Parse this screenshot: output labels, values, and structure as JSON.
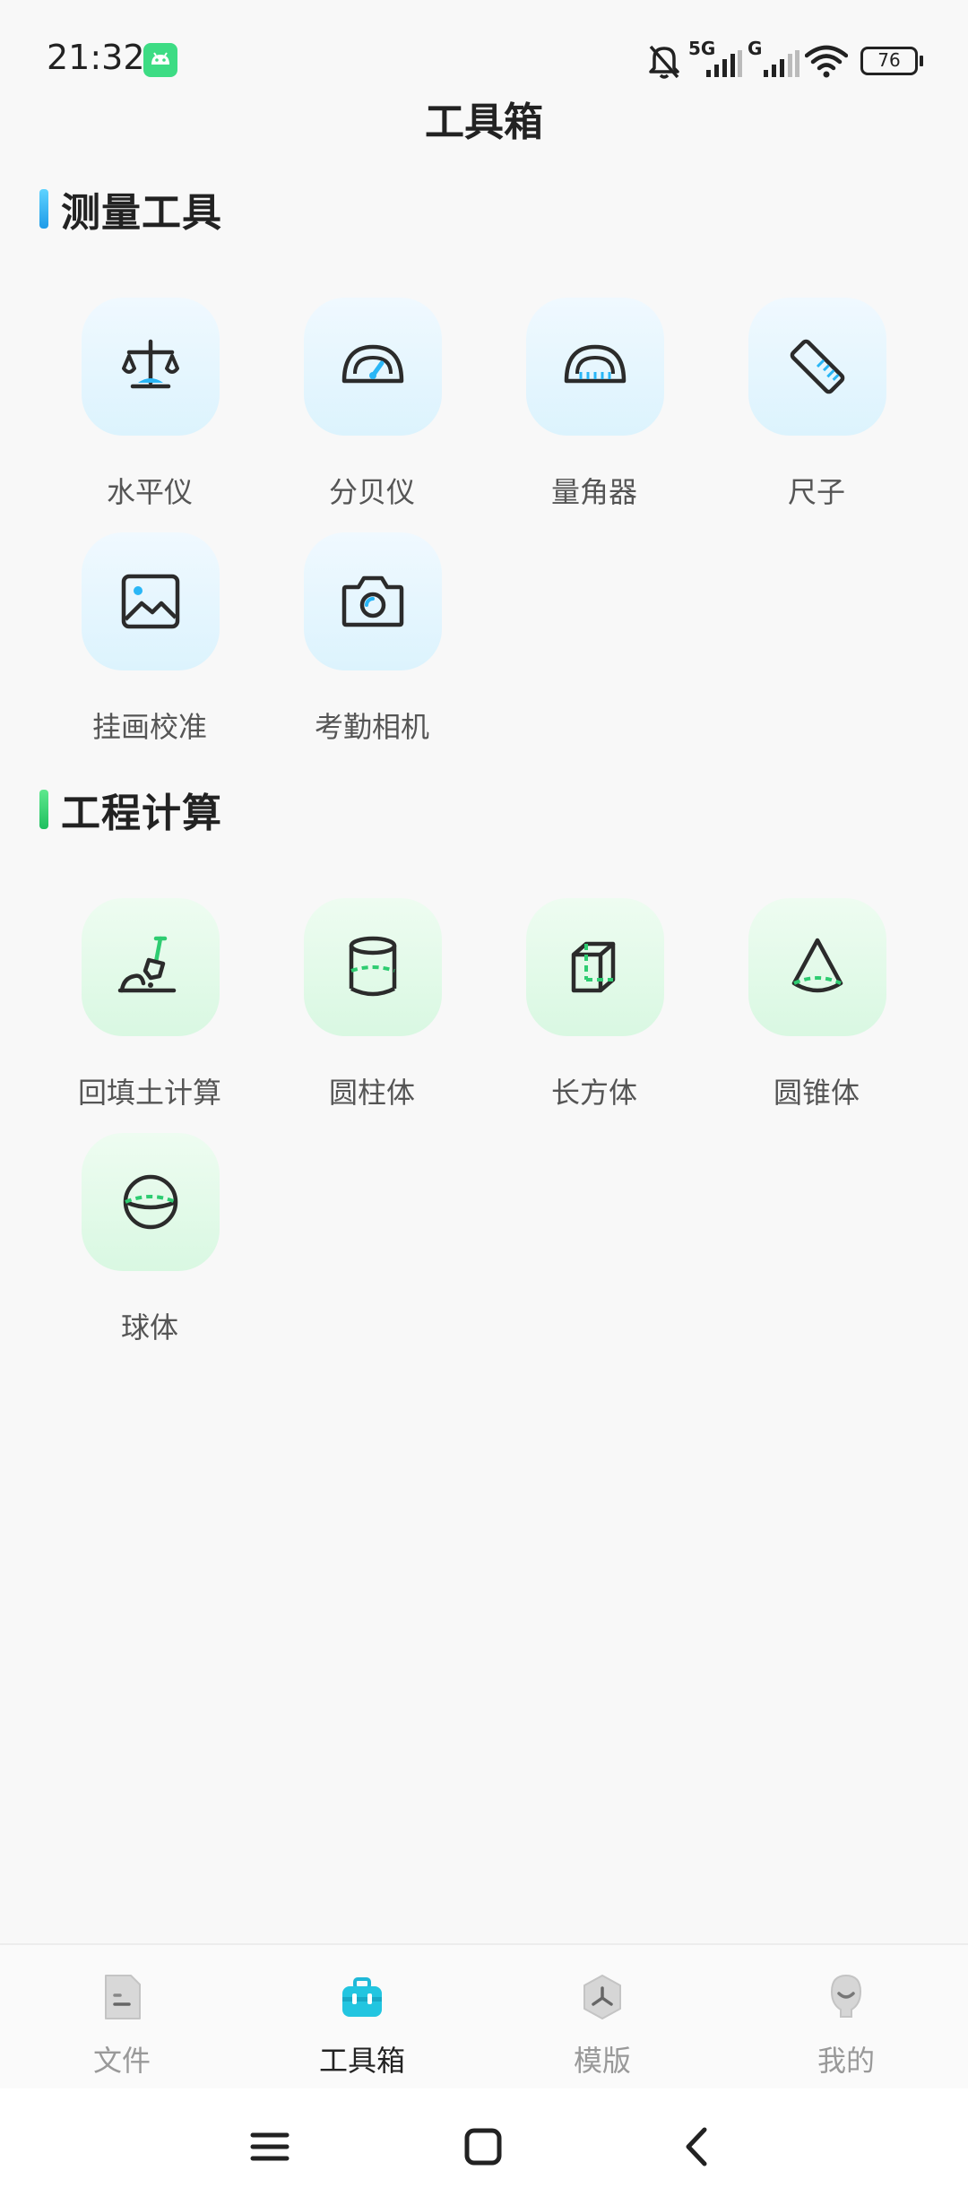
{
  "status_bar": {
    "time": "21:32",
    "network_1": "5G",
    "network_2": "G",
    "battery": "76",
    "icons": [
      "android-app-icon",
      "bell-muted-icon",
      "signal-icon",
      "signal-icon",
      "wifi-icon",
      "battery-icon"
    ]
  },
  "page": {
    "title": "工具箱"
  },
  "sections": [
    {
      "title": "测量工具",
      "accent": "#29b6f6",
      "items": [
        {
          "label": "水平仪",
          "icon": "level-icon"
        },
        {
          "label": "分贝仪",
          "icon": "decibel-meter-icon"
        },
        {
          "label": "量角器",
          "icon": "protractor-icon"
        },
        {
          "label": "尺子",
          "icon": "ruler-icon"
        },
        {
          "label": "挂画校准",
          "icon": "picture-frame-icon"
        },
        {
          "label": "考勤相机",
          "icon": "camera-icon"
        }
      ]
    },
    {
      "title": "工程计算",
      "accent": "#2ecc71",
      "items": [
        {
          "label": "回填土计算",
          "icon": "shovel-icon"
        },
        {
          "label": "圆柱体",
          "icon": "cylinder-icon"
        },
        {
          "label": "长方体",
          "icon": "cuboid-icon"
        },
        {
          "label": "圆锥体",
          "icon": "cone-icon"
        },
        {
          "label": "球体",
          "icon": "sphere-icon"
        }
      ]
    }
  ],
  "bottom_nav": {
    "active": "工具箱",
    "items": [
      {
        "label": "文件",
        "icon": "file-icon"
      },
      {
        "label": "工具箱",
        "icon": "toolbox-icon"
      },
      {
        "label": "模版",
        "icon": "template-icon"
      },
      {
        "label": "我的",
        "icon": "profile-icon"
      }
    ]
  },
  "colors": {
    "blue_accent": "#29b6f6",
    "green_accent": "#2ecc71",
    "icon_stroke": "#2b2b2b"
  }
}
